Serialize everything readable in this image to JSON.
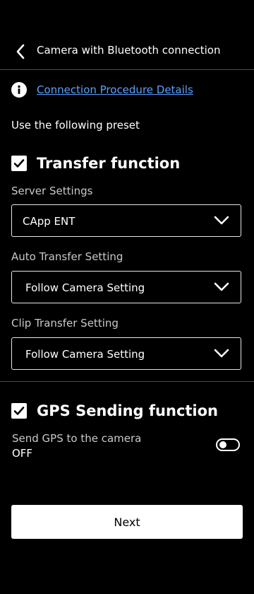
{
  "header": {
    "title": "Camera with Bluetooth connection",
    "back_icon": "chevron-left-icon"
  },
  "info": {
    "icon": "info-icon",
    "link_label": "Connection Procedure Details"
  },
  "preset_text": "Use the following preset",
  "transfer": {
    "checked": true,
    "title": "Transfer function",
    "server_label": "Server Settings",
    "server_value": "CApp ENT",
    "auto_label": "Auto Transfer Setting",
    "auto_value": "Follow Camera Setting",
    "clip_label": "Clip Transfer Setting",
    "clip_value": "Follow Camera Setting"
  },
  "gps": {
    "checked": true,
    "title": "GPS Sending function",
    "send_label": "Send GPS to the camera",
    "send_state": "OFF",
    "toggle_on": false
  },
  "next_label": "Next",
  "colors": {
    "background": "#000000",
    "link": "#5aa0ff",
    "divider": "#4a4a4a"
  }
}
